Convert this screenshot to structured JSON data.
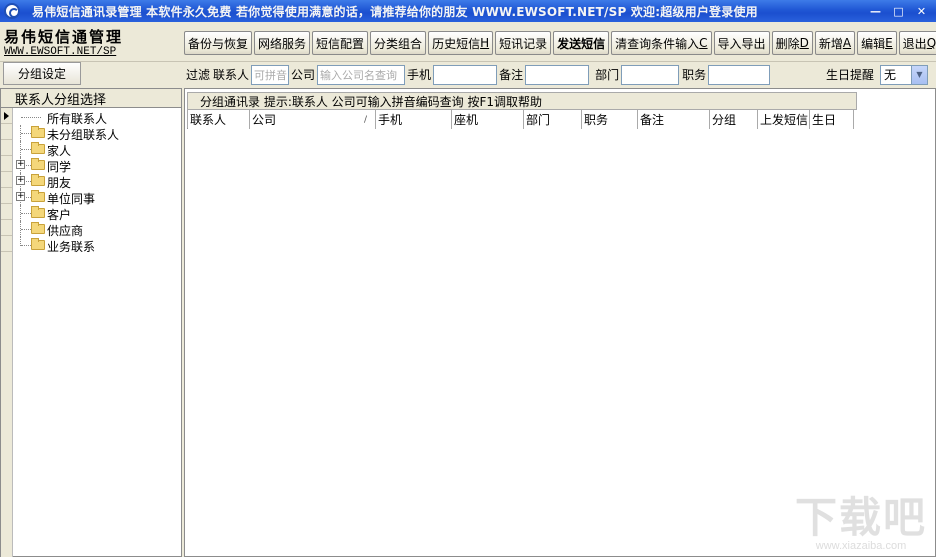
{
  "window": {
    "title": "易伟短信通讯录管理  本软件永久免费 若你觉得使用满意的话，请推荐给你的朋友  WWW.EWSOFT.NET/SP    欢迎:超级用户登录使用",
    "minimize_glyph": "—",
    "maximize_glyph": "□",
    "close_glyph": "✕"
  },
  "brand": {
    "title": "易伟短信通管理",
    "url": "WWW.EWSOFT.NET/SP"
  },
  "toolbar": {
    "buttons": [
      {
        "label": "备份与恢复"
      },
      {
        "label": "网络服务"
      },
      {
        "label": "短信配置"
      },
      {
        "label": "分类组合"
      },
      {
        "label": "历史短信",
        "hotkey": "H"
      },
      {
        "label": "短讯记录"
      },
      {
        "label": "发送短信"
      },
      {
        "label": "清查询条件输入",
        "hotkey": "C"
      },
      {
        "label": "导入导出"
      },
      {
        "label": "删除",
        "hotkey": "D"
      },
      {
        "label": "新增",
        "hotkey": "A"
      },
      {
        "label": "编辑",
        "hotkey": "E"
      },
      {
        "label": "退出",
        "hotkey": "Q"
      }
    ]
  },
  "left_tab": {
    "label": "分组设定"
  },
  "filter": {
    "label": "过滤",
    "contact_label": "联系人",
    "contact_placeholder": "可拼音",
    "company_label": "公司",
    "company_placeholder": "输入公司名查询",
    "mobile_label": "手机",
    "note_label": "备注",
    "dept_label": "部门",
    "title_label": "职务",
    "birthday_label": "生日提醒",
    "birthday_value": "无"
  },
  "tree": {
    "header": "联系人分组选择",
    "items": [
      {
        "label": "所有联系人",
        "expandable": false
      },
      {
        "label": "未分组联系人",
        "expandable": false
      },
      {
        "label": "家人",
        "expandable": false
      },
      {
        "label": "同学",
        "expandable": true
      },
      {
        "label": "朋友",
        "expandable": true
      },
      {
        "label": "单位同事",
        "expandable": true
      },
      {
        "label": "客户",
        "expandable": false
      },
      {
        "label": "供应商",
        "expandable": false
      },
      {
        "label": "业务联系",
        "expandable": false
      }
    ]
  },
  "grid": {
    "caption": "分组通讯录  提示:联系人 公司可输入拼音编码查询 按F1调取帮助",
    "columns": [
      "联系人",
      "公司",
      "手机",
      "座机",
      "部门",
      "职务",
      "备注",
      "分组",
      "上发短信",
      "生日"
    ],
    "sort_glyph": "/"
  },
  "watermark": {
    "text": "下载吧",
    "url": "www.xiazaiba.com"
  }
}
